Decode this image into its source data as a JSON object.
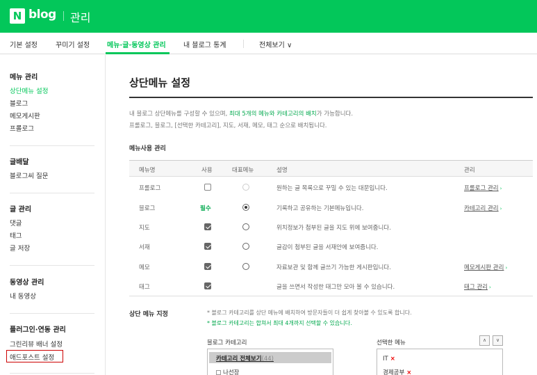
{
  "header": {
    "logo_letter": "N",
    "logo_text": "blog",
    "title": "관리"
  },
  "tabs": [
    {
      "label": "기본 설정"
    },
    {
      "label": "꾸미기 설정"
    },
    {
      "label": "메뉴·글·동영상 관리"
    },
    {
      "label": "내 블로그 통계"
    },
    {
      "label": "전체보기 ∨"
    }
  ],
  "sidebar": {
    "groups": [
      {
        "title": "메뉴 관리",
        "items": [
          "상단메뉴 설정",
          "블로그",
          "메모게시판",
          "프롤로그"
        ]
      },
      {
        "title": "글배달",
        "items": [
          "블로그씨 질문"
        ]
      },
      {
        "title": "글 관리",
        "items": [
          "댓글",
          "태그",
          "글 저장"
        ]
      },
      {
        "title": "동영상 관리",
        "items": [
          "내 동영상"
        ]
      },
      {
        "title": "플러그인·연동 관리",
        "items": [
          "그린리뷰 배너 설정",
          "애드포스트 설정"
        ]
      }
    ]
  },
  "main": {
    "title": "상단메뉴 설정",
    "desc1_a": "내 블로그 상단메뉴를 구성할 수 있으며,",
    "desc1_b": "최대 5개의 메뉴와 카테고리의 배치",
    "desc1_c": "가 가능합니다.",
    "desc2": "프롤로그, 블로그, [선택한 카테고리], 지도, 서재, 메모, 태그 순으로 배치됩니다.",
    "section1": "메뉴사용 관리",
    "table": {
      "headers": [
        "메뉴명",
        "사용",
        "대표메뉴",
        "설명",
        "관리"
      ],
      "rows": [
        {
          "name": "프롤로그",
          "use": "unchecked",
          "required_label": "",
          "rep": "disabled",
          "desc": "원하는 글 목록으로 꾸밀 수 있는 대문입니다.",
          "manage": "프롤로그 관리"
        },
        {
          "name": "블로그",
          "use": "required",
          "required_label": "필수",
          "rep": "selected",
          "desc": "기록하고 공유하는 기본메뉴입니다.",
          "manage": "카테고리 관리"
        },
        {
          "name": "지도",
          "use": "checked",
          "required_label": "",
          "rep": "unselected",
          "desc": "위치정보가 첨부된 글을 지도 위에 보여줍니다.",
          "manage": ""
        },
        {
          "name": "서재",
          "use": "checked",
          "required_label": "",
          "rep": "unselected",
          "desc": "글감이 첨부된 글을 서재안에 보여줍니다.",
          "manage": ""
        },
        {
          "name": "메모",
          "use": "checked",
          "required_label": "",
          "rep": "unselected",
          "desc": "자료보관 및 함께 글쓰기 가능한 게시판입니다.",
          "manage": "메모게시판 관리"
        },
        {
          "name": "태그",
          "use": "checked",
          "required_label": "",
          "rep": "none",
          "desc": "글을 쓰면서 작성한 태그만 모아 볼 수 있습니다.",
          "manage": "태그 관리"
        }
      ]
    },
    "section2": "상단 메뉴 지정",
    "note1": "* 블로그 카테고리를 상단 메뉴에 배치하여 방문자들이 더 쉽게 찾아볼 수 있도록 합니다.",
    "note2": "* 블로그 카테고리는 합쳐서 최대 4개까지 선택할 수 있습니다.",
    "list_left_label": "블로그 카테고리",
    "list_left_items": [
      {
        "label": "카테고리 전체보기",
        "count": "(44)"
      },
      {
        "label": "나선장"
      }
    ],
    "list_right_label": "선택한 메뉴",
    "list_right_items": [
      {
        "label": "IT",
        "remove": "×"
      },
      {
        "label": "경제공부",
        "remove": "×"
      }
    ],
    "up_button": "∧",
    "down_button": "∨",
    "arrow_glyph": "›",
    "colors": {
      "brand": "#03c75a",
      "highlight_border": "#cc0000"
    }
  }
}
